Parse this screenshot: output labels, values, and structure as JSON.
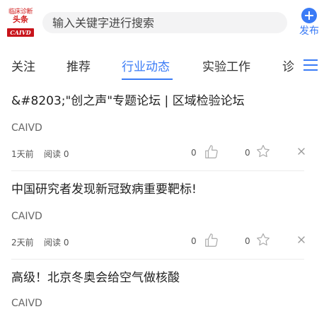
{
  "header": {
    "logo": {
      "line1": "临床诊断",
      "line2": "头条",
      "badge": "CAIVD"
    },
    "search": {
      "placeholder": "输入关键字进行搜索"
    },
    "publish": {
      "label": "发布",
      "icon": "plus-circle-icon"
    }
  },
  "tabs": [
    {
      "label": "关注",
      "active": false
    },
    {
      "label": "推荐",
      "active": false
    },
    {
      "label": "行业动态",
      "active": true
    },
    {
      "label": "实验工作",
      "active": false
    },
    {
      "label": "诊",
      "active": false
    }
  ],
  "menu_icon": "hamburger-menu-icon",
  "feed": [
    {
      "title": "&#8203;\"创之声\"专题论坛 | 区域检验论坛",
      "source": "CAIVD",
      "time": "1天前",
      "reads": "阅读 0",
      "likes": "0",
      "favorites": "0"
    },
    {
      "title": "中国研究者发现新冠致病重要靶标!",
      "source": "CAIVD",
      "time": "2天前",
      "reads": "阅读 0",
      "likes": "0",
      "favorites": "0"
    },
    {
      "title": "高级！北京冬奥会给空气做核酸",
      "source": "CAIVD"
    }
  ],
  "colors": {
    "accent": "#3a7bf6",
    "logo_red": "#c8141b"
  }
}
